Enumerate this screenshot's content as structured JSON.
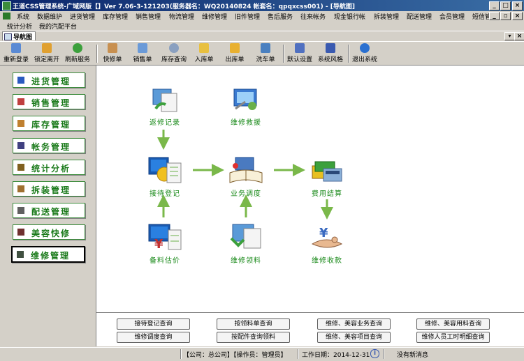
{
  "window": {
    "title": "王道CSS管理系统-广域网版【】Ver 7.06-3-121203(服务器名：WQ20140824 帐套名：qpqxcss001) - [导航图]",
    "controls": [
      "_",
      "□",
      "×"
    ],
    "inner_controls": [
      "_",
      "▫",
      "×"
    ]
  },
  "menu": {
    "row1": [
      "系统",
      "数据维护",
      "进货管理",
      "库存管理",
      "销售管理",
      "物流管理",
      "维修管理",
      "旧件管理",
      "售后服务",
      "往来帐务",
      "现金银行帐",
      "拆装管理",
      "配送管理",
      "会员管理",
      "短信管理"
    ],
    "row2": [
      "统计分析",
      "我的汽配平台"
    ]
  },
  "doc_tab": {
    "label": "导航图",
    "close": "×",
    "dropdown": "▾"
  },
  "toolbar": {
    "group1": [
      "重新登录",
      "锁定离开",
      "刷新服务"
    ],
    "group2": [
      "快修单",
      "销售单",
      "库存查询",
      "入库单",
      "出库单",
      "洗车单"
    ],
    "group3": [
      "默认设置",
      "系统风格"
    ],
    "group4": [
      "退出系统"
    ]
  },
  "nav": {
    "items": [
      {
        "label": "进货管理"
      },
      {
        "label": "销售管理"
      },
      {
        "label": "库存管理"
      },
      {
        "label": "帐务管理"
      },
      {
        "label": "统计分析"
      },
      {
        "label": "拆装管理"
      },
      {
        "label": "配送管理"
      },
      {
        "label": "美容快修"
      },
      {
        "label": "维修管理"
      }
    ],
    "active_index": 8
  },
  "flow": {
    "return_record": "返修记录",
    "repair_rescue": "维修救援",
    "reception": "接待登记",
    "dispatch": "业务调度",
    "settlement": "费用结算",
    "parts_quote": "备料估价",
    "parts_pick": "维修领料",
    "payment": "维修收款"
  },
  "queries": {
    "row1": [
      "接待登记查询",
      "按领料单查询",
      "维修、美容业务查询",
      "维修、美容用料查询"
    ],
    "row2": [
      "维修调度查询",
      "按配件查询领料",
      "维修、美容项目查询",
      "维修人员工时明细查询"
    ]
  },
  "status": {
    "company": "【公司：总公司】【操作员：管理员】",
    "date": "工作日期：2014-12-31",
    "info_icon": "i",
    "message": "没有新消息"
  },
  "colors": {
    "accent_green": "#1a8a1a",
    "title_blue": "#0a246a"
  }
}
